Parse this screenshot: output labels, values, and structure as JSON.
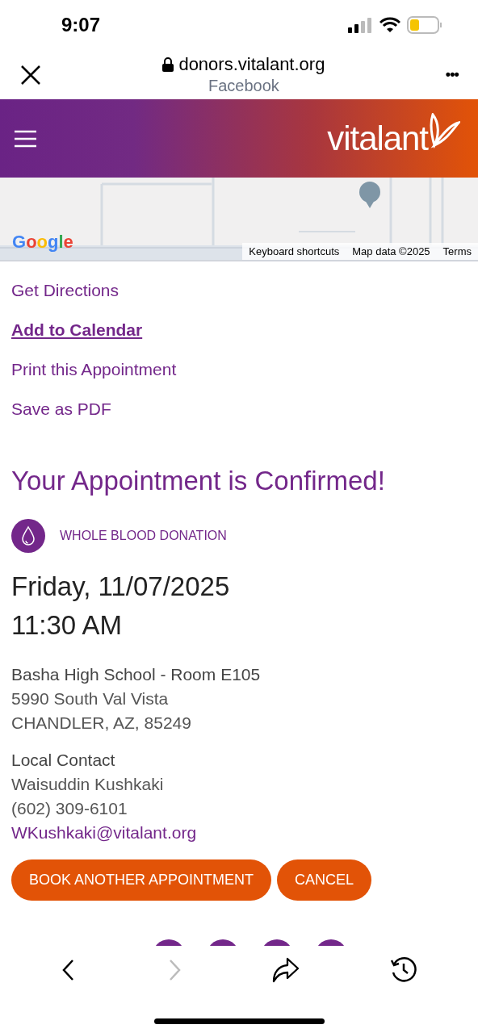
{
  "status_bar": {
    "time": "9:07"
  },
  "browser": {
    "domain": "donors.vitalant.org",
    "source": "Facebook",
    "menu": "•••"
  },
  "header": {
    "logo": "vitalant"
  },
  "map": {
    "google": "Google",
    "attribution": [
      "Keyboard shortcuts",
      "Map data ©2025",
      "Terms"
    ]
  },
  "links": [
    {
      "label": "Get Directions",
      "focused": false
    },
    {
      "label": "Add to Calendar",
      "focused": true
    },
    {
      "label": "Print this Appointment",
      "focused": false
    },
    {
      "label": "Save as PDF",
      "focused": false
    }
  ],
  "confirmation": {
    "title": "Your Appointment is Confirmed!",
    "type": "WHOLE BLOOD DONATION",
    "date": "Friday, 11/07/2025",
    "time": "11:30 AM",
    "location": [
      "Basha High School - Room E105",
      "5990 South Val Vista",
      "CHANDLER, AZ, 85249"
    ],
    "contact_heading": "Local Contact",
    "contact": [
      "Waisuddin Kushkaki",
      "(602) 309-6101"
    ],
    "email": "WKushkaki@vitalant.org"
  },
  "buttons": [
    "BOOK ANOTHER APPOINTMENT",
    "CANCEL"
  ],
  "toolbar": {
    "back_disabled": false,
    "forward_disabled": true
  }
}
